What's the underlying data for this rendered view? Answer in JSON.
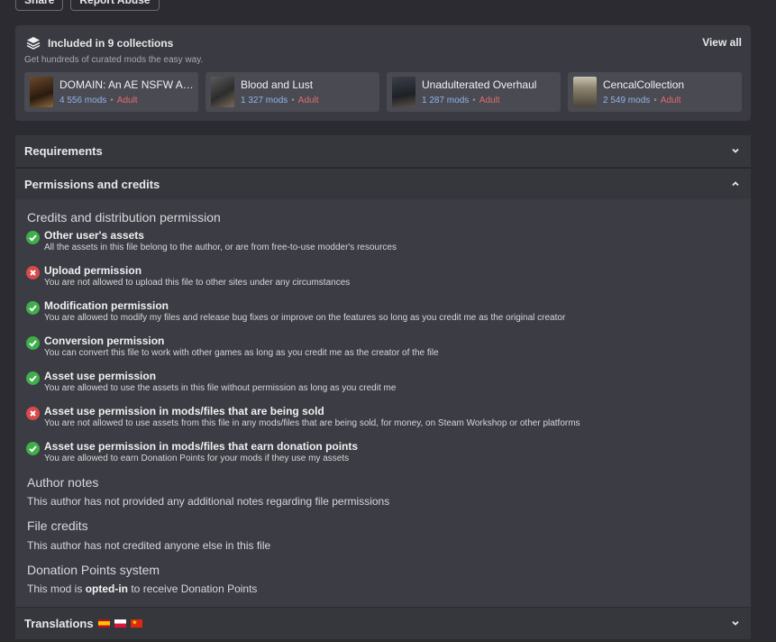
{
  "top_buttons": [
    "Share",
    "Report Abuse"
  ],
  "collections": {
    "title": "Included in 9 collections",
    "view_all": "View all",
    "subtitle": "Get hundreds of curated mods the easy way.",
    "items": [
      {
        "title": "DOMAIN: An AE NSFW AI...",
        "mods": "4 556 mods",
        "badge": "Adult"
      },
      {
        "title": "Blood and Lust",
        "mods": "1 327 mods",
        "badge": "Adult"
      },
      {
        "title": "Unadulterated Overhaul",
        "mods": "1 287 mods",
        "badge": "Adult"
      },
      {
        "title": "CencalCollection",
        "mods": "2 549 mods",
        "badge": "Adult"
      }
    ]
  },
  "accordions": {
    "requirements": "Requirements",
    "permissions": "Permissions and credits",
    "translations": "Translations"
  },
  "permissions": {
    "heading": "Credits and distribution permission",
    "items": [
      {
        "status": "allowed",
        "title": "Other user's assets",
        "desc": "All the assets in this file belong to the author, or are from free-to-use modder's resources"
      },
      {
        "status": "denied",
        "title": "Upload permission",
        "desc": "You are not allowed to upload this file to other sites under any circumstances"
      },
      {
        "status": "allowed",
        "title": "Modification permission",
        "desc": "You are allowed to modify my files and release bug fixes or improve on the features so long as you credit me as the original creator"
      },
      {
        "status": "allowed",
        "title": "Conversion permission",
        "desc": "You can convert this file to work with other games as long as you credit me as the creator of the file"
      },
      {
        "status": "allowed",
        "title": "Asset use permission",
        "desc": "You are allowed to use the assets in this file without permission as long as you credit me"
      },
      {
        "status": "denied",
        "title": "Asset use permission in mods/files that are being sold",
        "desc": "You are not allowed to use assets from this file in any mods/files that are being sold, for money, on Steam Workshop or other platforms"
      },
      {
        "status": "allowed",
        "title": "Asset use permission in mods/files that earn donation points",
        "desc": "You are allowed to earn Donation Points for your mods if they use my assets"
      }
    ],
    "author_notes_title": "Author notes",
    "author_notes": "This author has not provided any additional notes regarding file permissions",
    "file_credits_title": "File credits",
    "file_credits": "This author has not credited anyone else in this file",
    "donation_title": "Donation Points system",
    "donation_prefix": "This mod is ",
    "donation_bold": "opted-in",
    "donation_suffix": " to receive Donation Points"
  },
  "colors": {
    "allowed": "#3fae4b",
    "denied": "#d94a4a",
    "adult": "#e06c6c",
    "mods_count": "#8fb4e8"
  }
}
